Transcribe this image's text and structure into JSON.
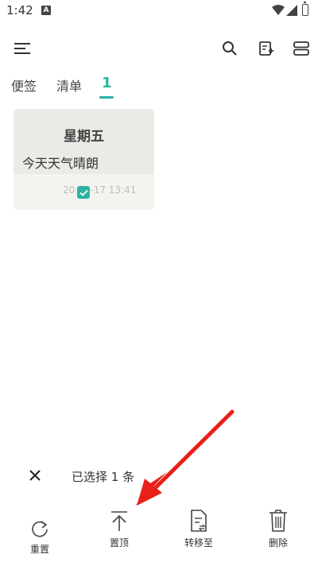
{
  "status_bar": {
    "time": "1:42",
    "notification_letter": "A"
  },
  "toolbar": {
    "menu_icon": "hamburger-icon",
    "search_icon": "search-icon",
    "new_note_icon": "add-note-icon",
    "layout_icon": "view-toggle-icon"
  },
  "tabs": [
    {
      "label": "便签",
      "active": false
    },
    {
      "label": "清单",
      "active": false
    },
    {
      "label": "1",
      "active": true
    }
  ],
  "note": {
    "title": "星期五",
    "body": "今天天气晴朗",
    "date": "20  04-17 13:41",
    "selected": true
  },
  "selection": {
    "text": "已选择 1 条"
  },
  "actions": [
    {
      "label": "重置",
      "icon": "refresh-icon"
    },
    {
      "label": "置顶",
      "icon": "pin-top-icon"
    },
    {
      "label": "转移至",
      "icon": "move-to-icon"
    },
    {
      "label": "删除",
      "icon": "trash-icon"
    }
  ],
  "colors": {
    "accent": "#2bb3a4",
    "annotation_arrow": "#e8201a"
  }
}
